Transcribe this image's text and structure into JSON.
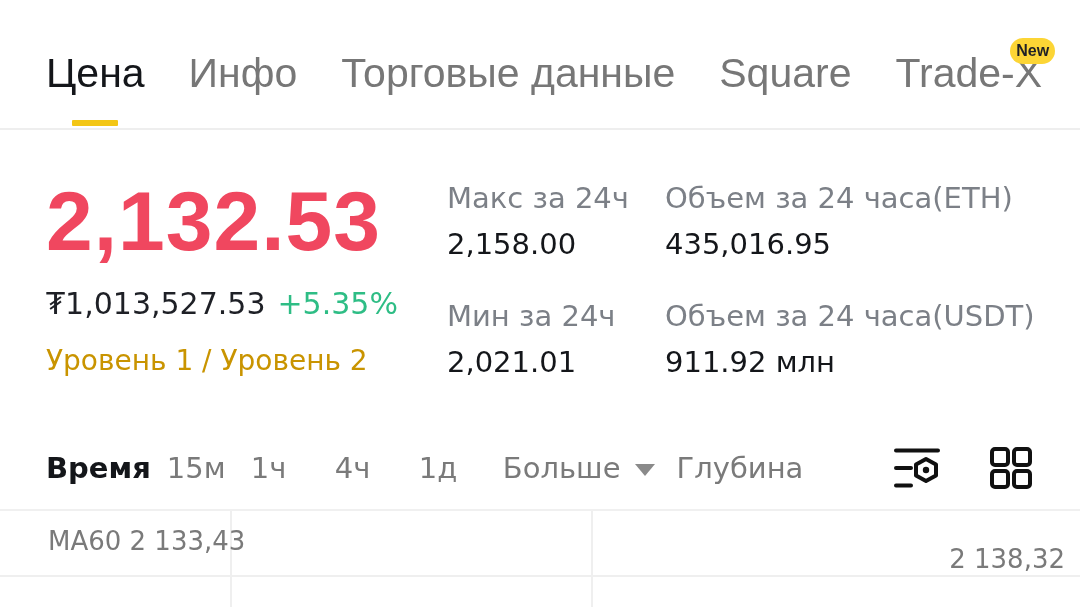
{
  "tabs": [
    {
      "label": "Цена",
      "selected": true
    },
    {
      "label": "Инфо",
      "selected": false
    },
    {
      "label": "Торговые данные",
      "selected": false
    },
    {
      "label": "Square",
      "selected": false
    },
    {
      "label": "Trade-X",
      "selected": false,
      "badge": "New"
    }
  ],
  "ticker": {
    "price": "2,132.53",
    "price_rising": false,
    "fiat_price": "₮1,013,527.53",
    "change": "+5.35%",
    "change_rising": true,
    "levels_link": "Уровень 1 / Уровень 2"
  },
  "stats": [
    {
      "label": "Макс за 24ч",
      "value": "2,158.00"
    },
    {
      "label": "Объем за 24 часа(ETH)",
      "value": "435,016.95"
    },
    {
      "label": "Мин за 24ч",
      "value": "2,021.01"
    },
    {
      "label": "Объем за 24 часа(USDT)",
      "value": "911.92 млн"
    }
  ],
  "chart_toolbar": {
    "intervals": [
      {
        "label": "Время",
        "kind": "option",
        "selected": true
      },
      {
        "label": "15м",
        "kind": "option",
        "selected": false
      },
      {
        "label": "1ч",
        "kind": "option",
        "selected": false
      },
      {
        "label": "4ч",
        "kind": "option",
        "selected": false
      },
      {
        "label": "1д",
        "kind": "option",
        "selected": false
      },
      {
        "label": "Больше",
        "kind": "dropdown",
        "selected": false
      },
      {
        "label": "Глубина",
        "kind": "option",
        "selected": false
      }
    ]
  },
  "chart": {
    "ma_label": "MA60 2 133,43",
    "price_label": "2 138,32"
  }
}
